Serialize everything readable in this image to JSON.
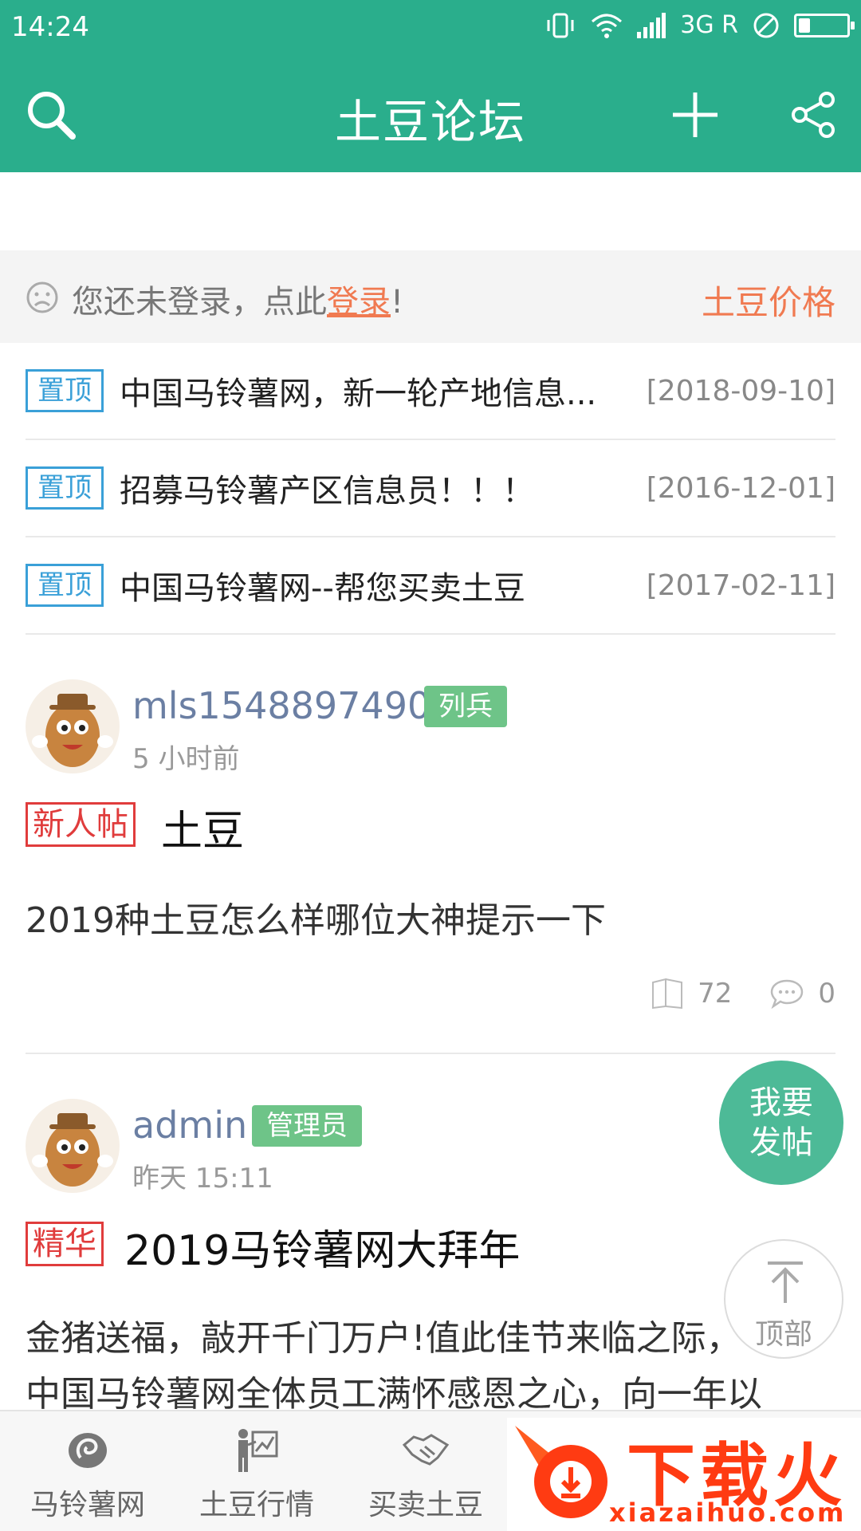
{
  "status_bar": {
    "time": "14:24",
    "network": "3G R"
  },
  "header": {
    "title": "土豆论坛"
  },
  "login_bar": {
    "prefix": "您还未登录，点此",
    "link": "登录",
    "suffix": "!",
    "price_link": "土豆价格"
  },
  "pinned": [
    {
      "tag": "置顶",
      "text": "中国马铃薯网，新一轮产地信息...",
      "date": "[2018-09-10]"
    },
    {
      "tag": "置顶",
      "text": "招募马铃薯产区信息员！！！",
      "date": "[2016-12-01]"
    },
    {
      "tag": "置顶",
      "text": "中国马铃薯网--帮您买卖土豆",
      "date": "[2017-02-11]"
    }
  ],
  "posts": [
    {
      "username": "mls1548897490",
      "rank": "列兵",
      "time": "5 小时前",
      "tag": "新人帖",
      "title": "土豆",
      "body": "2019种土豆怎么样哪位大神提示一下",
      "views": "72",
      "comments": "0"
    },
    {
      "username": "admin",
      "rank": "管理员",
      "time": "昨天 15:11",
      "tag": "精华",
      "title": "2019马铃薯网大拜年",
      "body_line1": "金猪送福，敲开千门万户!值此佳节来临之际，",
      "body_line2": "中国马铃薯网全体员工满怀感恩之心，向一年以"
    }
  ],
  "fab": {
    "line1": "我要",
    "line2": "发帖"
  },
  "to_top": {
    "label": "顶部"
  },
  "tabs": [
    {
      "label": "马铃薯网"
    },
    {
      "label": "土豆行情"
    },
    {
      "label": "买卖土豆"
    }
  ],
  "ad": {
    "brand": "下载火",
    "url": "xiazaihuo.com"
  },
  "colors": {
    "primary": "#2aae8c",
    "accent": "#f07a51",
    "tag_blue": "#3aa0d8",
    "tag_red": "#e03c3c",
    "rank_green": "#6ec488"
  }
}
